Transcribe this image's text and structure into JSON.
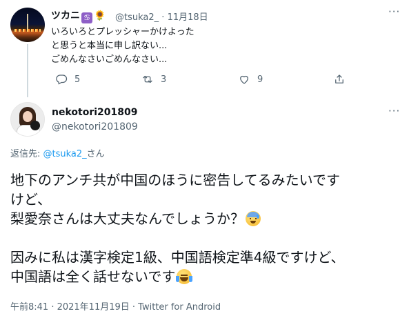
{
  "parent_tweet": {
    "display_name": "ツカニ",
    "zodiac_badge": "♋",
    "sun_emoji": "🌻",
    "handle": "@tsuka2_",
    "separator": "·",
    "date": "11月18日",
    "text_lines": [
      "いろいろとプレッシャーかけよった",
      "と思うと本当に申し訳ない...",
      "ごめんなさいごめんなさい..."
    ],
    "reply_count": "5",
    "retweet_count": "3",
    "like_count": "9",
    "more": "···"
  },
  "main_tweet": {
    "display_name": "nekotori201809",
    "handle": "@nekotori201809",
    "more": "···",
    "reply_to_prefix": "返信先: ",
    "reply_to_handle": "@tsuka2_",
    "reply_to_suffix": "さん",
    "text_lines": [
      "地下のアンチ共が中国のほうに密告してるみたいです",
      "けど、",
      "梨愛奈さんは大丈夫なんでしょうか？",
      "",
      "因みに私は漢字検定1級、中国語検定準4級ですけど、",
      "中国語は全く話せないです"
    ],
    "emoji_1": "anxious-face-with-sweat",
    "emoji_2": "face-with-tears-of-joy",
    "footer": "午前8:41 · 2021年11月19日 · Twitter for Android"
  },
  "colors": {
    "text": "#0f1419",
    "secondary": "#536471",
    "link": "#1d9bf0",
    "thread_line": "#cfd9de"
  }
}
